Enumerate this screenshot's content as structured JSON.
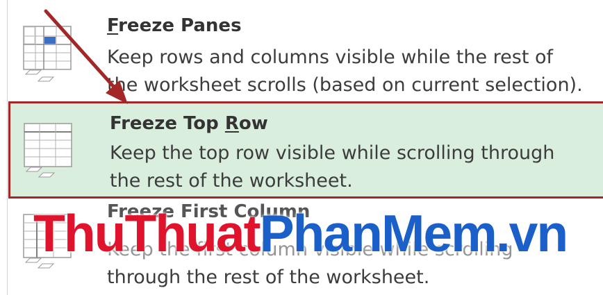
{
  "menu": {
    "items": [
      {
        "title_pre": "",
        "title_key": "F",
        "title_post": "reeze Panes",
        "desc_lines": [
          "Keep rows and columns visible while the rest of",
          "the worksheet scrolls (based on current selection)."
        ],
        "icon": "freeze-panes-icon"
      },
      {
        "title_pre": "Freeze Top ",
        "title_key": "R",
        "title_post": "ow",
        "desc_lines": [
          "Keep the top row visible while scrolling through",
          "the rest of the worksheet."
        ],
        "icon": "freeze-top-row-icon",
        "highlighted": true
      },
      {
        "title_pre": "Freeze First Column",
        "title_key": "",
        "title_post": "",
        "desc_lines": [
          "Keep the first column visible while scrolling",
          "through the rest of the worksheet."
        ],
        "icon": "freeze-first-column-icon"
      }
    ]
  },
  "watermark": {
    "part1": "ThuThuat",
    "part2": "PhanMem.vn"
  },
  "colors": {
    "highlight_bg": "#d9eedd",
    "highlight_border": "#a42727",
    "arrow": "#a42727",
    "watermark_red": "#e0132d",
    "watermark_blue": "#1b5fc9",
    "icon_accent": "#3b6fc4"
  }
}
